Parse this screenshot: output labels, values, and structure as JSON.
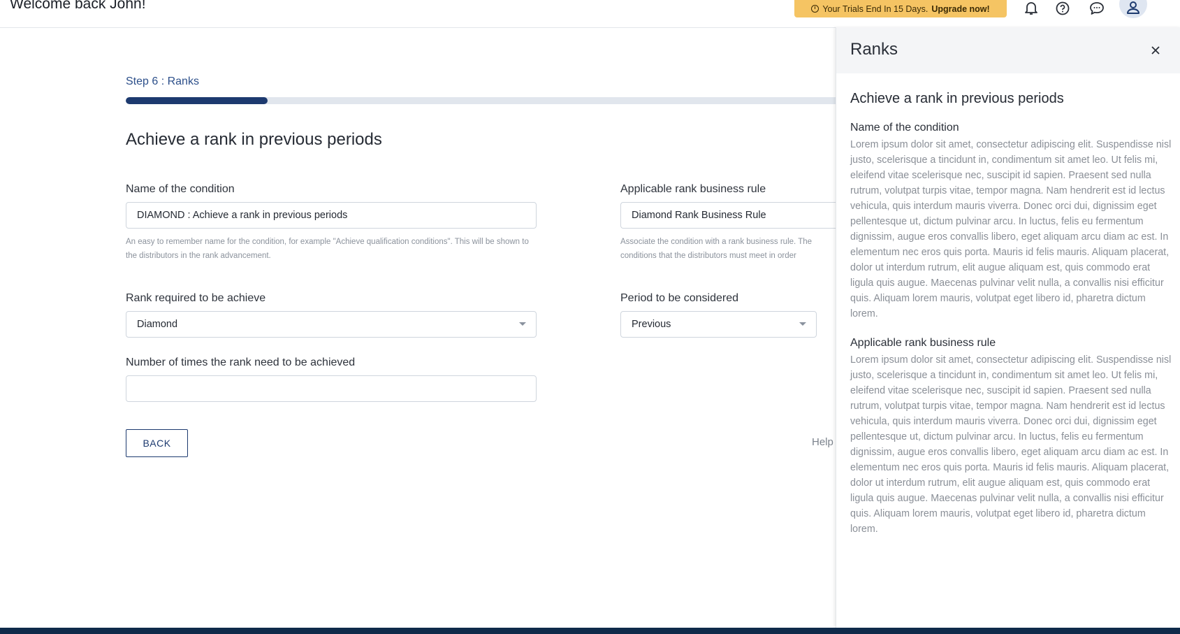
{
  "header": {
    "welcome": "Welcome back John!",
    "trial_text": "Your Trials End In 15 Days.",
    "upgrade_link": "Upgrade now!",
    "icons": [
      "bell-icon",
      "help-circle-icon",
      "chat-icon",
      "user-icon"
    ]
  },
  "form": {
    "step": "Step 6 : Ranks",
    "progress_percent": 20,
    "title": "Achieve a rank in previous periods",
    "condition_name": {
      "label": "Name of the condition",
      "value": "DIAMOND : Achieve a rank in previous periods",
      "hint": "An easy to remember name for the condition, for example \"Achieve qualification conditions\". This will be shown to the distributors in the rank advancement."
    },
    "business_rule": {
      "label": "Applicable rank business rule",
      "value": "Diamond Rank Business Rule",
      "hint": "Associate the condition with a rank business rule. The conditions that the distributors must meet in order"
    },
    "rank_required": {
      "label": "Rank required to be achieve",
      "value": "Diamond"
    },
    "period": {
      "label": "Period to be considered",
      "value": "Previous"
    },
    "times": {
      "label": "Number of times the rank need to be achieved",
      "value": ""
    },
    "back_button": "BACK",
    "help_label": "Help"
  },
  "drawer": {
    "title": "Ranks",
    "subtitle": "Achieve a rank in previous periods",
    "section1_title": "Name of the condition",
    "section1_text": "Lorem ipsum dolor sit amet, consectetur adipiscing elit. Suspendisse nisl justo, scelerisque a tincidunt in, condimentum sit amet leo. Ut felis mi, eleifend vitae scelerisque nec, suscipit id sapien. Praesent sed nulla rutrum, volutpat turpis vitae, tempor magna. Nam hendrerit est id lectus vehicula, quis interdum mauris viverra. Donec orci dui, dignissim eget pellentesque ut, dictum pulvinar arcu. In luctus, felis eu fermentum dignissim, augue eros convallis libero, eget aliquam arcu diam ac est. In elementum nec eros quis porta. Mauris id felis mauris. Aliquam placerat, dolor ut interdum rutrum, elit augue aliquam est, quis commodo erat ligula quis augue. Maecenas pulvinar velit nulla, a convallis nisi efficitur quis. Aliquam lorem mauris, volutpat eget libero id, pharetra dictum lorem.",
    "section2_title": "Applicable rank business rule",
    "section2_text": "Lorem ipsum dolor sit amet, consectetur adipiscing elit. Suspendisse nisl justo, scelerisque a tincidunt in, condimentum sit amet leo. Ut felis mi, eleifend vitae scelerisque nec, suscipit id sapien. Praesent sed nulla rutrum, volutpat turpis vitae, tempor magna. Nam hendrerit est id lectus vehicula, quis interdum mauris viverra. Donec orci dui, dignissim eget pellentesque ut, dictum pulvinar arcu. In luctus, felis eu fermentum dignissim, augue eros convallis libero, eget aliquam arcu diam ac est. In elementum nec eros quis porta. Mauris id felis mauris. Aliquam placerat, dolor ut interdum rutrum, elit augue aliquam est, quis commodo erat ligula quis augue. Maecenas pulvinar velit nulla, a convallis nisi efficitur quis. Aliquam lorem mauris, volutpat eget libero id, pharetra dictum lorem."
  },
  "colors": {
    "primary": "#1d3a6f",
    "trial_banner": "#f5c463",
    "footer": "#0f2a4a"
  }
}
